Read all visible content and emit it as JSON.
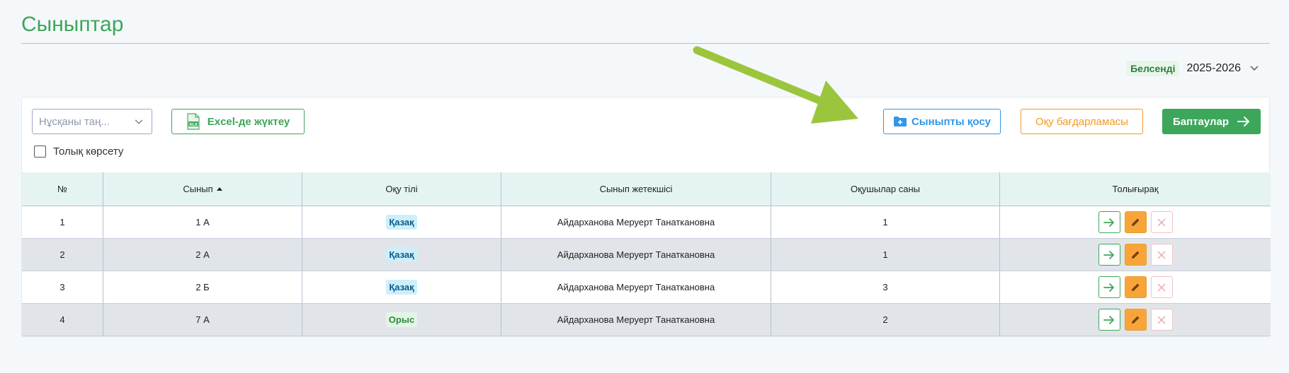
{
  "header": {
    "title": "Сыныптар"
  },
  "year": {
    "status": "Белсенді",
    "value": "2025-2026"
  },
  "toolbar": {
    "select_placeholder": "Нұсқаны таң...",
    "excel_label": "Excel-де жүктеу",
    "excel_icon_text": "XLS",
    "add_class_label": "Сыныпты қосу",
    "program_label": "Оқу бағдарламасы",
    "settings_label": "Баптаулар",
    "full_view_label": "Толық көрсету"
  },
  "table": {
    "columns": [
      "№",
      "Сынып",
      "Оқу тілі",
      "Сынып жетекшісі",
      "Оқушылар саны",
      "Толығырақ"
    ],
    "rows": [
      {
        "num": "1",
        "class": "1 А",
        "lang": "Қазақ",
        "teacher": "Айдарханова Меруерт Танаткановна",
        "count": "1"
      },
      {
        "num": "2",
        "class": "2 А",
        "lang": "Қазақ",
        "teacher": "Айдарханова Меруерт Танаткановна",
        "count": "1"
      },
      {
        "num": "3",
        "class": "2 Б",
        "lang": "Қазақ",
        "teacher": "Айдарханова Меруерт Танаткановна",
        "count": "3"
      },
      {
        "num": "4",
        "class": "7 А",
        "lang": "Орыс",
        "teacher": "Айдарханова Меруерт Танаткановна",
        "count": "2"
      }
    ]
  },
  "colors": {
    "brand_green": "#3ca75a",
    "accent_blue": "#2f97e8",
    "accent_orange": "#f29b24",
    "annotation_arrow": "#9bc53d"
  },
  "icons": [
    "chevron-down-icon",
    "xls-file-icon",
    "folder-plus-icon",
    "arrow-right-icon",
    "pencil-icon",
    "close-icon"
  ]
}
